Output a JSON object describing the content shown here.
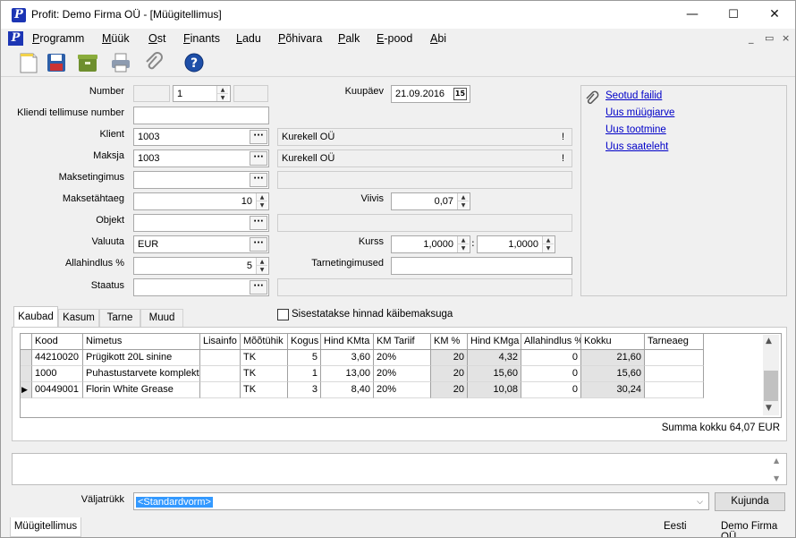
{
  "window": {
    "title": "Profit: Demo Firma OÜ - [Müügitellimus]",
    "logo_letter": "P",
    "minimize": "—",
    "maximize": "☐",
    "close": "✕"
  },
  "menu": {
    "items": [
      "Programm",
      "Müük",
      "Ost",
      "Finants",
      "Ladu",
      "Põhivara",
      "Palk",
      "E-pood",
      "Abi"
    ],
    "mdi_controls": [
      "_",
      "▭",
      "×"
    ]
  },
  "toolbar": {
    "buttons": [
      "new-document-icon",
      "save-icon",
      "archive-box-icon",
      "print-icon",
      "attach-icon",
      "help-icon"
    ]
  },
  "form": {
    "labels": {
      "number": "Number",
      "client_order_no": "Kliendi tellimuse number",
      "client": "Klient",
      "payer": "Maksja",
      "payment_term": "Maksetingimus",
      "due_days": "Maksetähtaeg",
      "object": "Objekt",
      "currency": "Valuuta",
      "discount": "Allahindlus %",
      "status": "Staatus",
      "date": "Kuupäev",
      "delay": "Viivis",
      "rate": "Kurss",
      "delivery_terms": "Tarnetingimused"
    },
    "values": {
      "number": "1",
      "client_order_no": "",
      "client": "1003",
      "client_name": "Kurekell OÜ",
      "client_flag": "!",
      "payer": "1003",
      "payer_name": "Kurekell OÜ",
      "payer_flag": "!",
      "payment_term": "",
      "due_days": "10",
      "object": "",
      "currency": "EUR",
      "discount": "5",
      "status": "",
      "date": "21.09.2016",
      "calendar_day": "15",
      "delay": "0,07",
      "rate1": "1,0000",
      "rate_sep": ":",
      "rate2": "1,0000",
      "delivery_terms": ""
    },
    "lookup_label": "···"
  },
  "links": [
    "Seotud failid",
    "Uus müügiarve",
    "Uus tootmine",
    "Uus saateleht"
  ],
  "tabs": [
    "Kaubad",
    "Kasum",
    "Tarne",
    "Muud"
  ],
  "vat_checkbox": {
    "label": "Sisestatakse hinnad käibemaksuga",
    "checked": false
  },
  "grid": {
    "columns": [
      "",
      "Kood",
      "Nimetus",
      "Lisainfo",
      "Mõõtühik",
      "Kogus",
      "Hind KMta",
      "KM Tariif",
      "KM %",
      "Hind KMga",
      "Allahindlus %",
      "Kokku",
      "Tarneaeg"
    ],
    "rows": [
      {
        "marker": "",
        "kood": "44210020",
        "nimetus": "Prügikott 20L sinine",
        "lisainfo": "",
        "uhik": "TK",
        "kogus": "5",
        "hind": "3,60",
        "tariif": "20%",
        "km": "20",
        "hind_km": "4,32",
        "allah": "0",
        "kokku": "21,60",
        "tarne": ""
      },
      {
        "marker": "",
        "kood": "1000",
        "nimetus": "Puhastustarvete komplekt",
        "lisainfo": "",
        "uhik": "TK",
        "kogus": "1",
        "hind": "13,00",
        "tariif": "20%",
        "km": "20",
        "hind_km": "15,60",
        "allah": "0",
        "kokku": "15,60",
        "tarne": ""
      },
      {
        "marker": "▶",
        "kood": "00449001",
        "nimetus": "Florin White Grease",
        "lisainfo": "",
        "uhik": "TK",
        "kogus": "3",
        "hind": "8,40",
        "tariif": "20%",
        "km": "20",
        "hind_km": "10,08",
        "allah": "0",
        "kokku": "30,24",
        "tarne": ""
      }
    ],
    "total": "Summa kokku 64,07 EUR"
  },
  "print": {
    "label": "Väljatrükk",
    "selected": "<Standardvorm>",
    "button": "Kujunda"
  },
  "status": {
    "tab": "Müügitellimus",
    "language": "Eesti",
    "company": "Demo Firma OÜ"
  }
}
